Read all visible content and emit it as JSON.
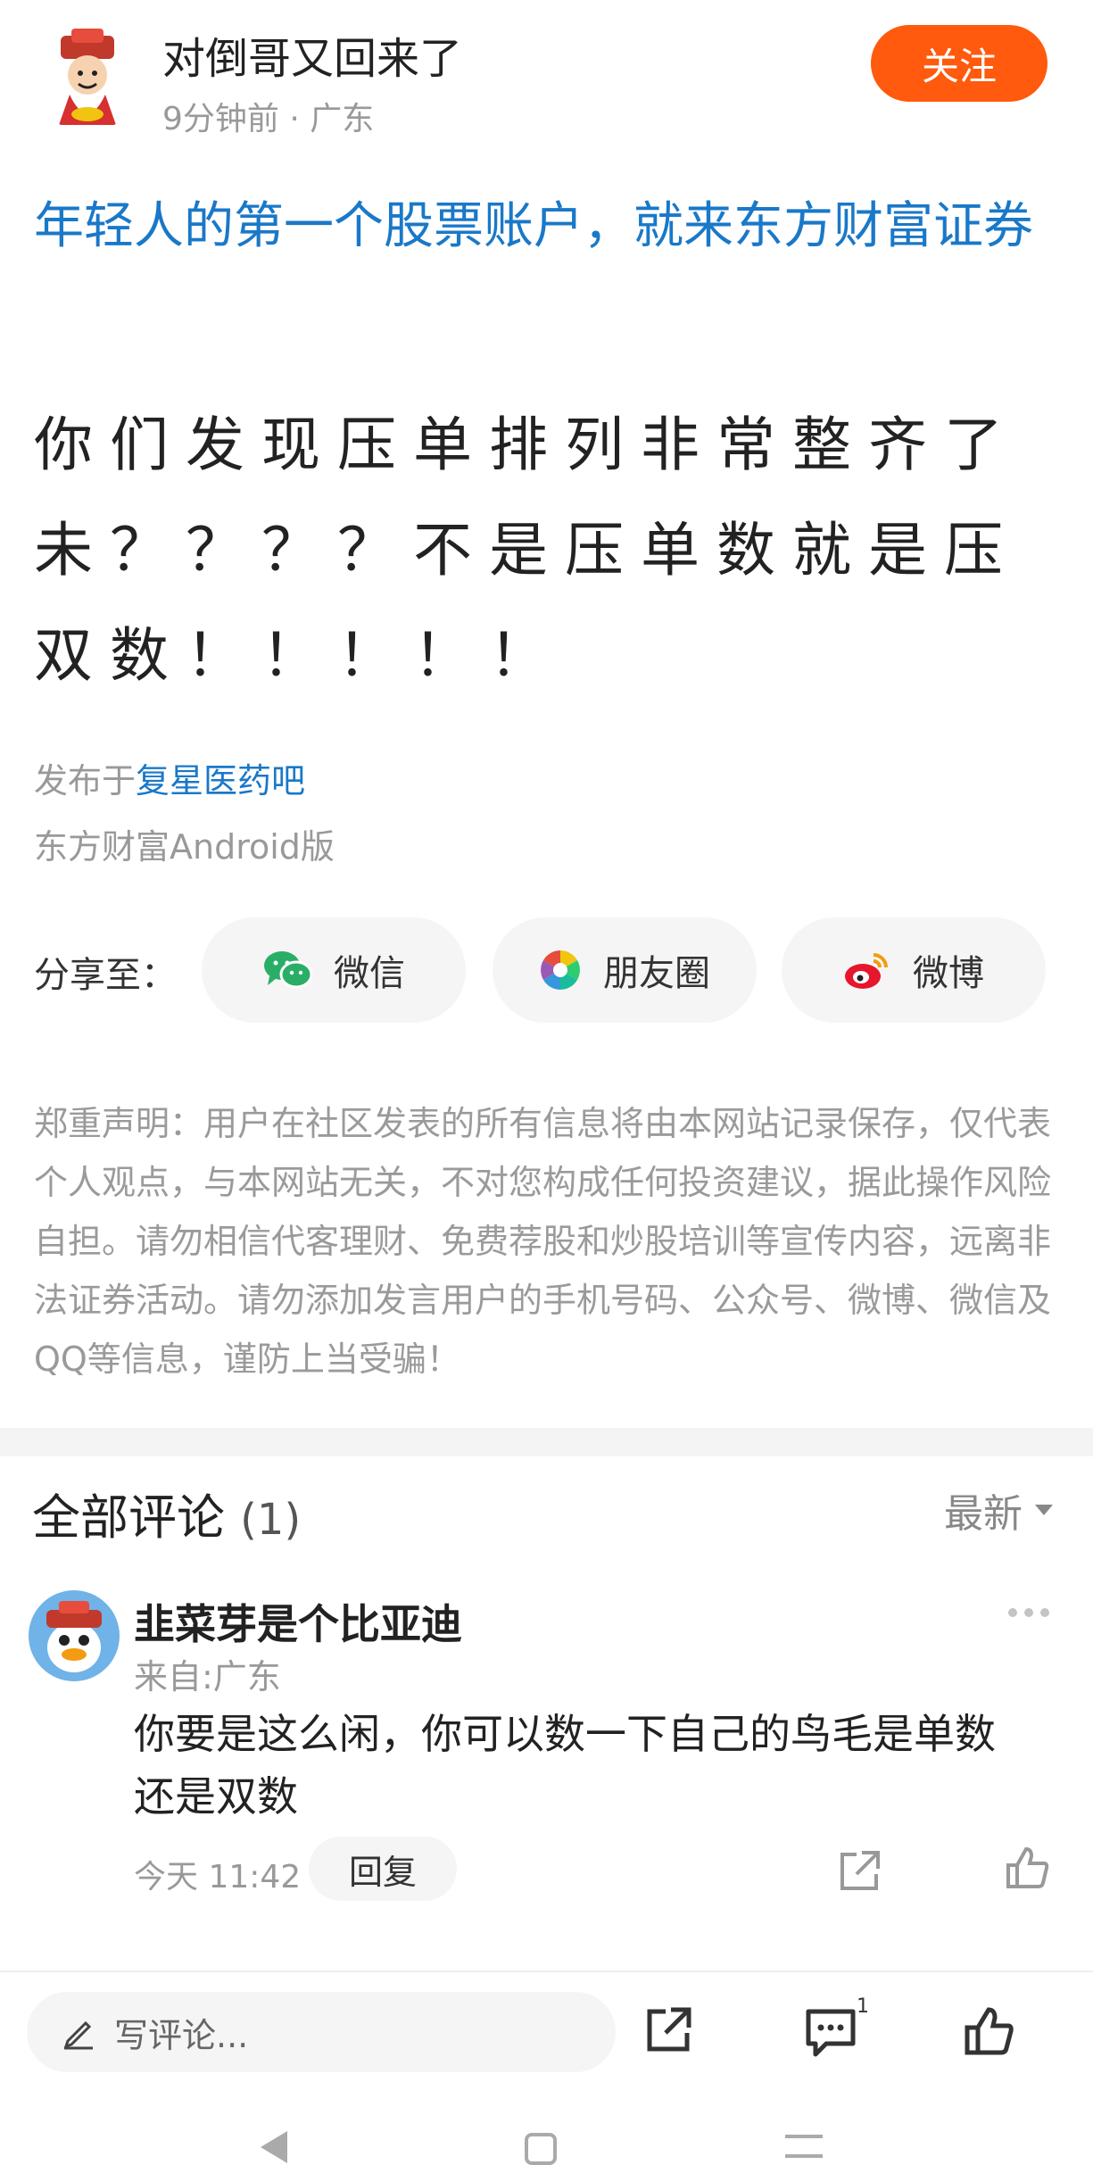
{
  "header": {
    "author_name": "对倒哥又回来了",
    "meta": "9分钟前 · 广东",
    "follow_label": "关注"
  },
  "promo_link": "年轻人的第一个股票账户，就来东方财富证券",
  "post": {
    "body": "你们发现压单排列非常整齐了未？？？？不是压单数就是压双数！！！！！",
    "published_prefix": "发布于",
    "forum": "复星医药吧",
    "client": "东方财富Android版"
  },
  "share": {
    "label": "分享至：",
    "wechat": "微信",
    "moments": "朋友圈",
    "weibo": "微博"
  },
  "disclaimer": "郑重声明：用户在社区发表的所有信息将由本网站记录保存，仅代表个人观点，与本网站无关，不对您构成任何投资建议，据此操作风险自担。请勿相信代客理财、免费荐股和炒股培训等宣传内容，远离非法证券活动。请勿添加发言用户的手机号码、公众号、微博、微信及QQ等信息，谨防上当受骗！",
  "comments": {
    "title": "全部评论",
    "count": "(1)",
    "sort_label": "最新",
    "items": [
      {
        "user": "韭菜芽是个比亚迪",
        "from": "来自:广东",
        "text": "你要是这么闲，你可以数一下自己的鸟毛是单数还是双数",
        "time": "今天 11:42",
        "reply_label": "回复"
      }
    ]
  },
  "bottom_bar": {
    "write_placeholder": "写评论...",
    "comment_badge": "1"
  },
  "colors": {
    "accent_orange": "#ff5a0d",
    "link_blue": "#1a78c8",
    "wechat_green": "#2aae67",
    "weibo_red": "#e6162d"
  },
  "icons": [
    "avatar-fortune-god",
    "wechat-icon",
    "moments-icon",
    "weibo-icon",
    "more-icon",
    "share-icon",
    "like-icon",
    "pencil-icon",
    "comment-icon",
    "back-icon",
    "home-icon",
    "menu-icon"
  ]
}
